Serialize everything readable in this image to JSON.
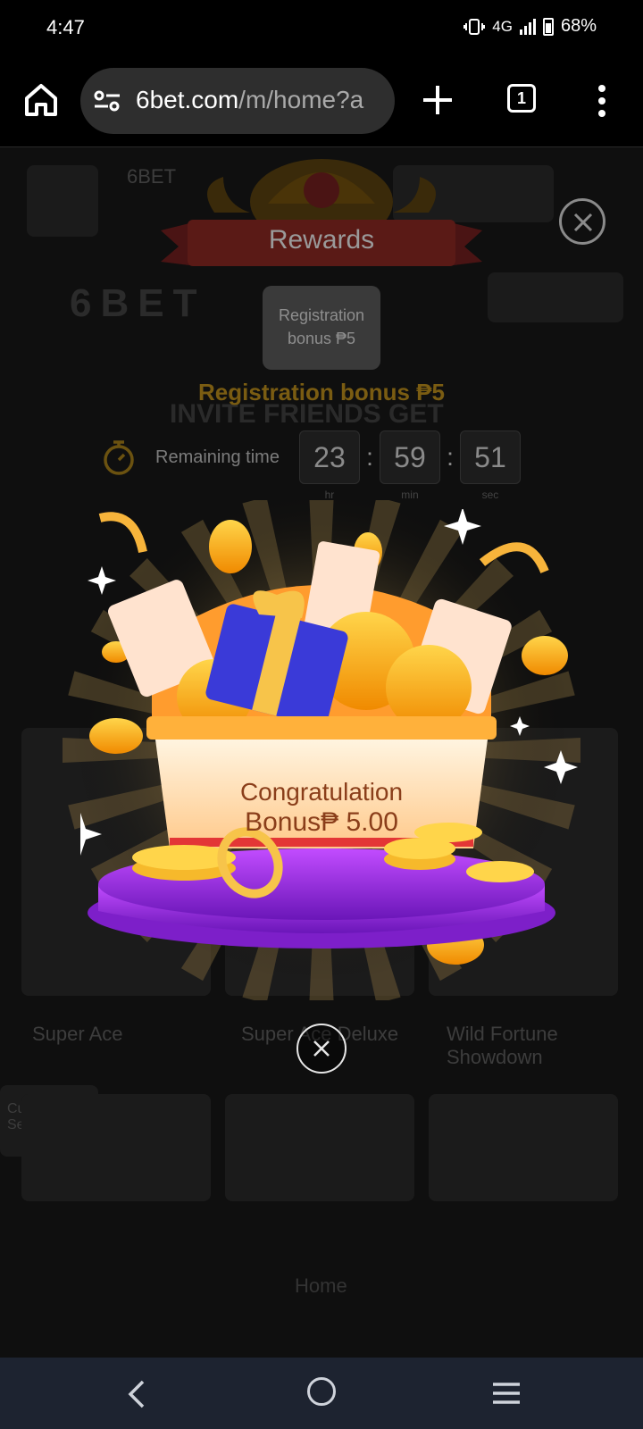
{
  "status_bar": {
    "time": "4:47",
    "network": "4G",
    "battery": "68%"
  },
  "browser": {
    "url_host": "6bet.com",
    "url_path": "/m/home?a",
    "tab_count": "1"
  },
  "background_page": {
    "brand_small": "6BET",
    "logo": "6BET",
    "headline_partial": "INVITE FRIENDS GET",
    "games": [
      "Super Ace",
      "Super Ace Deluxe",
      "Wild Fortune Showdown"
    ],
    "customer_service": "Customer Service",
    "nav_home": "Home"
  },
  "rewards_modal": {
    "title": "Rewards",
    "chip_label": "Registration bonus ₱5",
    "headline": "Registration bonus ₱5",
    "remaining_label": "Remaining time",
    "timer": {
      "hours": "23",
      "minutes": "59",
      "seconds": "51"
    },
    "timer_units": {
      "hours": "hr",
      "minutes": "min",
      "seconds": "sec"
    }
  },
  "bonus_popup": {
    "line1": "Congratulation",
    "line2": "Bonus₱ 5.00"
  },
  "colors": {
    "gold": "#f5a623",
    "purple": "#8e2bd6",
    "nav_bg": "#1d2330"
  }
}
